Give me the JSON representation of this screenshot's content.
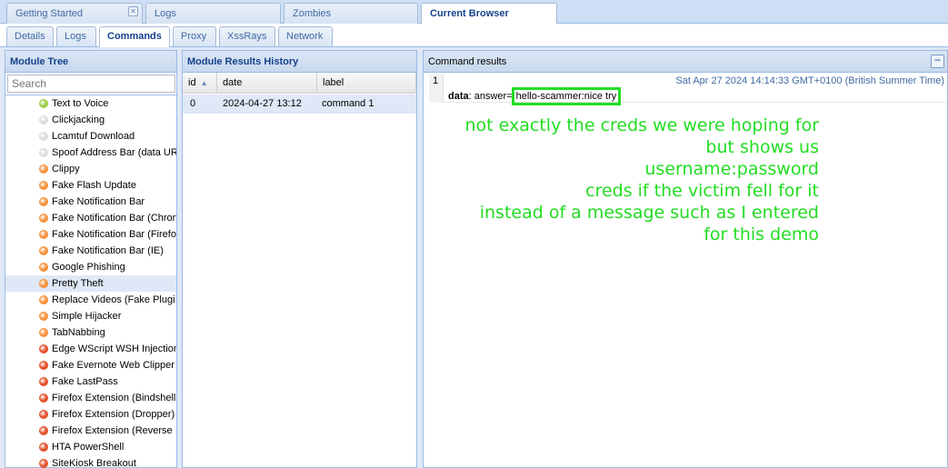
{
  "top_tabs": [
    {
      "label": "Getting Started",
      "closable": true
    },
    {
      "label": "Logs"
    },
    {
      "label": "Zombies"
    },
    {
      "label": "Current Browser",
      "active": true
    }
  ],
  "sub_tabs": [
    {
      "label": "Details"
    },
    {
      "label": "Logs"
    },
    {
      "label": "Commands",
      "active": true
    },
    {
      "label": "Proxy"
    },
    {
      "label": "XssRays"
    },
    {
      "label": "Network"
    }
  ],
  "module_tree": {
    "title": "Module Tree",
    "search_placeholder": "Search",
    "items": [
      {
        "label": "Text to Voice",
        "status": "green"
      },
      {
        "label": "Clickjacking",
        "status": "grey"
      },
      {
        "label": "Lcamtuf Download",
        "status": "grey"
      },
      {
        "label": "Spoof Address Bar (data UR",
        "status": "grey"
      },
      {
        "label": "Clippy",
        "status": "orange"
      },
      {
        "label": "Fake Flash Update",
        "status": "orange"
      },
      {
        "label": "Fake Notification Bar",
        "status": "orange"
      },
      {
        "label": "Fake Notification Bar (Chron",
        "status": "orange"
      },
      {
        "label": "Fake Notification Bar (Firefo",
        "status": "orange"
      },
      {
        "label": "Fake Notification Bar (IE)",
        "status": "orange"
      },
      {
        "label": "Google Phishing",
        "status": "orange"
      },
      {
        "label": "Pretty Theft",
        "status": "orange",
        "selected": true
      },
      {
        "label": "Replace Videos (Fake Plugi",
        "status": "orange"
      },
      {
        "label": "Simple Hijacker",
        "status": "orange"
      },
      {
        "label": "TabNabbing",
        "status": "orange"
      },
      {
        "label": "Edge WScript WSH Injection",
        "status": "red"
      },
      {
        "label": "Fake Evernote Web Clipper",
        "status": "red"
      },
      {
        "label": "Fake LastPass",
        "status": "red"
      },
      {
        "label": "Firefox Extension (Bindshell",
        "status": "red"
      },
      {
        "label": "Firefox Extension (Dropper)",
        "status": "red"
      },
      {
        "label": "Firefox Extension (Reverse",
        "status": "red"
      },
      {
        "label": "HTA PowerShell",
        "status": "red"
      },
      {
        "label": "SiteKiosk Breakout",
        "status": "red"
      }
    ]
  },
  "results_history": {
    "title": "Module Results History",
    "columns": [
      "id",
      "date",
      "label"
    ],
    "rows": [
      {
        "id": "0",
        "date": "2024-04-27 13:12",
        "label": "command 1"
      }
    ]
  },
  "command_results": {
    "title": "Command results",
    "collapse_label": "−",
    "row_number": "1",
    "timestamp": "Sat Apr 27 2024 14:14:33 GMT+0100 (British Summer Time)",
    "data_key": "data",
    "data_prefix": ": answer=",
    "data_value": "hello-scammer:nice try"
  },
  "annotation": "not exactly the creds we were hoping for\nbut shows us\nusername:password\ncreds if the victim fell for it\ninstead of a message such as I entered\nfor this demo",
  "colors": {
    "green": "#9ad045",
    "grey": "#dcdcdc",
    "orange": "#f5913a",
    "red": "#e4512c",
    "annotation": "#22dd22"
  }
}
